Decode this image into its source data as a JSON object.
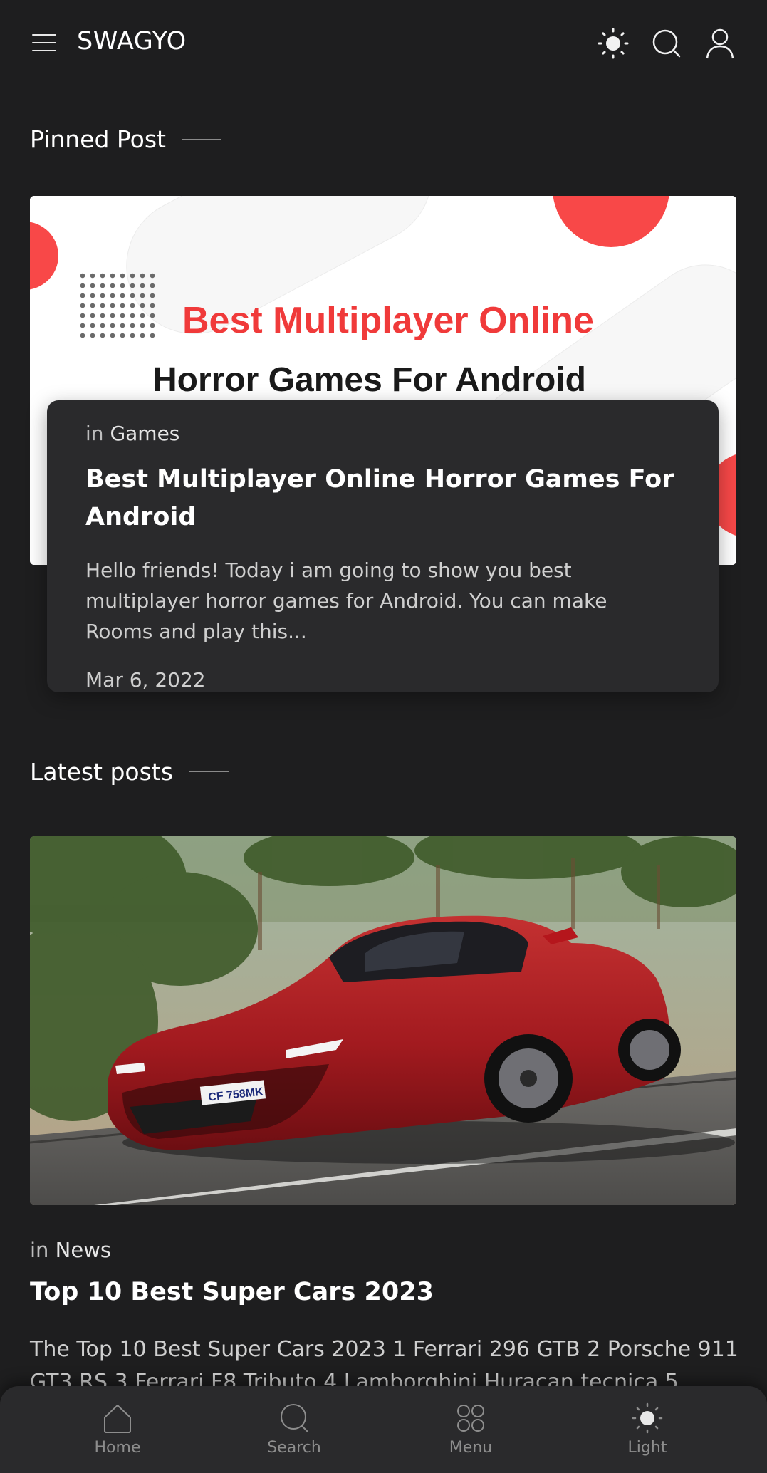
{
  "header": {
    "brand": "SWAGYO",
    "icons": [
      "menu-icon",
      "sun-icon",
      "search-icon",
      "user-icon"
    ]
  },
  "pinned": {
    "section_title": "Pinned Post",
    "image": {
      "line1": "Best Multiplayer Online",
      "line2": "Horror Games For Android",
      "accent_color": "#f84848"
    },
    "category_prefix": "in",
    "category": "Games",
    "title": "Best Multiplayer Online Horror Games For Android",
    "excerpt": "Hello friends! Today i am going to show you best multiplayer horror games for Android. You can make Rooms and play this...",
    "date": "Mar 6, 2022"
  },
  "latest": {
    "section_title": "Latest posts",
    "image": {
      "plate": "CF 758MK"
    },
    "category_prefix": "in",
    "category": "News",
    "title": "Top 10 Best Super Cars 2023",
    "excerpt": "The Top 10 Best Super Cars 2023 1   Ferrari 296 GTB 2 Porsche 911 GT3 RS 3 Ferrari F8 Tributo 4 Lamborghini Huracan tecnica 5"
  },
  "bottom_nav": {
    "items": [
      {
        "label": "Home",
        "icon": "home-icon"
      },
      {
        "label": "Search",
        "icon": "search-icon"
      },
      {
        "label": "Menu",
        "icon": "menu-grid-icon"
      },
      {
        "label": "Light",
        "icon": "sun-icon"
      }
    ]
  },
  "colors": {
    "background": "#1e1e1f",
    "card": "#2a2a2c",
    "accent": "#f84848"
  }
}
